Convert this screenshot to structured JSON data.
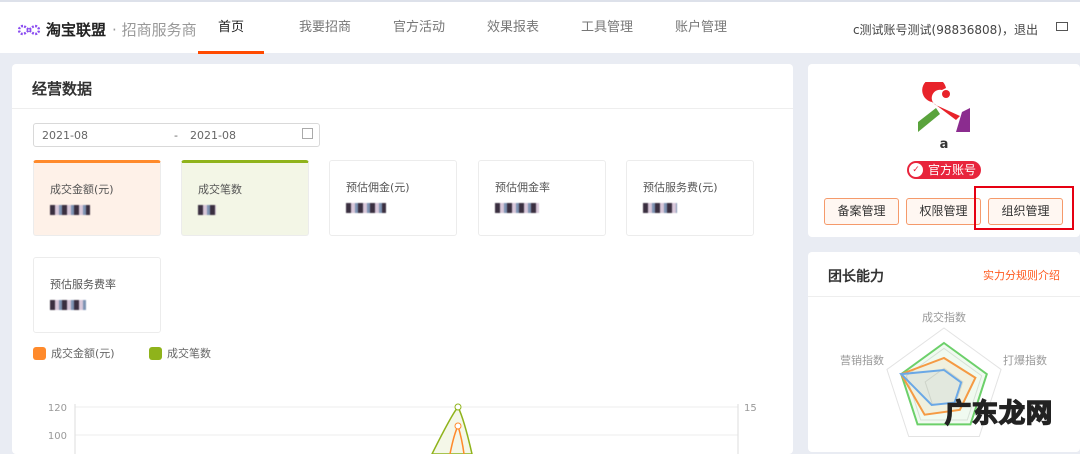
{
  "header": {
    "brand": "淘宝联盟",
    "brand_sub": "招商服务商",
    "nav": [
      "首页",
      "我要招商",
      "官方活动",
      "效果报表",
      "工具管理",
      "账户管理"
    ],
    "active_nav": 0,
    "user": "c测试账号测试(98836808)，退出"
  },
  "business": {
    "title": "经营数据",
    "date_start": "2021-08",
    "date_sep": "-",
    "date_end": "2021-08",
    "metrics": [
      {
        "label": "成交金额(元)"
      },
      {
        "label": "成交笔数"
      },
      {
        "label": "预估佣金(元)"
      },
      {
        "label": "预估佣金率"
      },
      {
        "label": "预估服务费(元)"
      },
      {
        "label": "预估服务费率"
      }
    ],
    "legend": [
      {
        "label": "成交金额(元)",
        "color": "#ff8a2b"
      },
      {
        "label": "成交笔数",
        "color": "#8fb31b"
      }
    ]
  },
  "chart_data": {
    "type": "line",
    "left_ticks": [
      "120",
      "100"
    ],
    "right_ticks": [
      "15"
    ],
    "series": [
      {
        "name": "成交金额(元)",
        "peak": 108
      },
      {
        "name": "成交笔数",
        "peak": 15
      }
    ]
  },
  "profile": {
    "name": "a",
    "badge": "官方账号",
    "buttons": [
      "备案管理",
      "权限管理",
      "组织管理"
    ]
  },
  "ability": {
    "title": "团长能力",
    "link": "实力分规则介绍",
    "axes": [
      "成交指数",
      "打爆指数",
      "营销指数"
    ],
    "radar": {
      "green": [
        0.75,
        0.75,
        0.75,
        0.75,
        0.75
      ],
      "orange": [
        0.5,
        0.55,
        0.45,
        0.55,
        0.75
      ],
      "blue": [
        0.3,
        0.3,
        0.3,
        0.35,
        0.75
      ]
    }
  },
  "watermark": "广东龙网"
}
